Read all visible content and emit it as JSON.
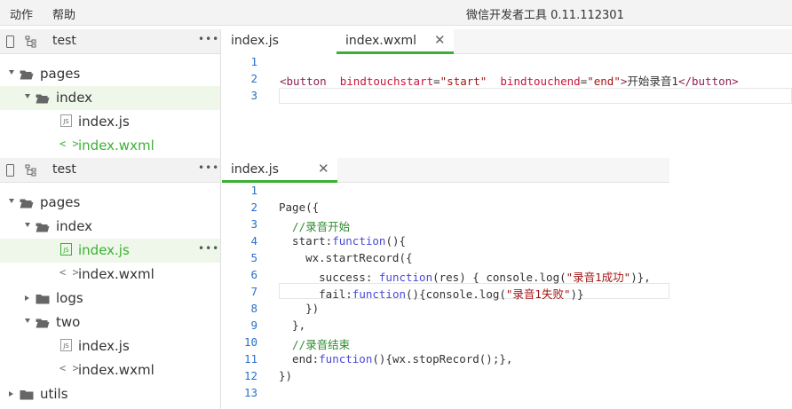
{
  "menubar": {
    "items": [
      "动作",
      "帮助"
    ],
    "window_title": "微信开发者工具 0.11.112301"
  },
  "colors": {
    "accent": "#3cb034",
    "selected_row": "#eef7ea",
    "line_numbers": "#2a6fc9"
  },
  "top_panel": {
    "sidebar": {
      "project": "test",
      "more": "•••",
      "tree": [
        {
          "label": "pages",
          "type": "folder",
          "expanded": true,
          "depth": 0
        },
        {
          "label": "index",
          "type": "folder",
          "expanded": true,
          "depth": 1,
          "selected": true
        },
        {
          "label": "index.js",
          "type": "js",
          "depth": 2
        },
        {
          "label": "index.wxml",
          "type": "wxml",
          "depth": 2,
          "active": true
        }
      ]
    },
    "editor": {
      "tabs": [
        {
          "label": "index.js",
          "active": false,
          "close": ""
        },
        {
          "label": "index.wxml",
          "active": true,
          "close": "✕"
        }
      ],
      "lines": [
        "",
        "<button  bindtouchstart=\"start\"  bindtouchend=\"end\">开始录音1</button>",
        ""
      ],
      "line_numbers": [
        "1",
        "2",
        "3"
      ]
    }
  },
  "bottom_panel": {
    "sidebar": {
      "project": "test",
      "more": "•••",
      "tree": [
        {
          "label": "pages",
          "type": "folder",
          "expanded": true,
          "depth": 0
        },
        {
          "label": "index",
          "type": "folder",
          "expanded": true,
          "depth": 1
        },
        {
          "label": "index.js",
          "type": "js",
          "depth": 2,
          "selected": true,
          "active": true,
          "more": "•••"
        },
        {
          "label": "index.wxml",
          "type": "wxml",
          "depth": 2
        },
        {
          "label": "logs",
          "type": "folder",
          "expanded": false,
          "depth": 1
        },
        {
          "label": "two",
          "type": "folder",
          "expanded": true,
          "depth": 1
        },
        {
          "label": "index.js",
          "type": "js",
          "depth": 2
        },
        {
          "label": "index.wxml",
          "type": "wxml",
          "depth": 2
        },
        {
          "label": "utils",
          "type": "folder",
          "expanded": false,
          "depth": 0
        }
      ]
    },
    "editor": {
      "tabs": [
        {
          "label": "index.js",
          "active": true,
          "close": "✕"
        }
      ],
      "line_numbers": [
        "1",
        "2",
        "3",
        "4",
        "5",
        "6",
        "7",
        "8",
        "9",
        "10",
        "11",
        "12",
        "13"
      ],
      "lines": [
        "",
        "Page({",
        "  //录音开始",
        "  start:function(){",
        "    wx.startRecord({",
        "      success: function(res) { console.log(\"录音1成功\")},",
        "      fail:function(){console.log(\"录音1失败\")}",
        "    })",
        "  },",
        "  //录音结束",
        "  end:function(){wx.stopRecord();},",
        "})",
        ""
      ]
    }
  }
}
